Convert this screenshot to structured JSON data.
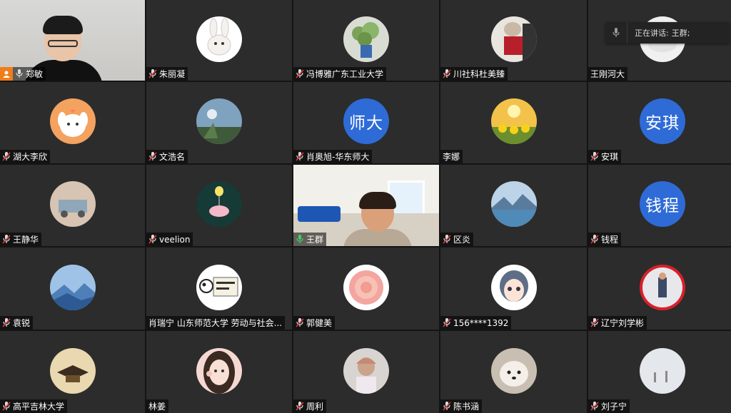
{
  "app": {
    "accent_color": "#2e6bd6",
    "active_border_color": "#1f9a4a",
    "host_badge_color": "#f07d1a"
  },
  "speaking_indicator": {
    "label": "正在讲话:",
    "name": "王群;"
  },
  "participants": [
    {
      "name": "郑敏",
      "mic": "on",
      "avatar": "video-man-glasses",
      "host": true
    },
    {
      "name": "朱丽凝",
      "mic": "muted",
      "avatar": "bunny-cartoon"
    },
    {
      "name": "冯博雅广东工业大学",
      "mic": "muted",
      "avatar": "potted-plant"
    },
    {
      "name": "川社科杜美臻",
      "mic": "muted",
      "avatar": "cat-with-red-book"
    },
    {
      "name": "王刚河大",
      "mic": "none",
      "avatar": "white-photo"
    },
    {
      "name": "湖大李欣",
      "mic": "muted",
      "avatar": "puppy-cartoon"
    },
    {
      "name": "文浩名",
      "mic": "muted",
      "avatar": "sky-landscape"
    },
    {
      "name": "肖奥旭-华东师大",
      "mic": "muted",
      "avatar_text": "师大"
    },
    {
      "name": "李娜",
      "mic": "none",
      "avatar": "sunflowers"
    },
    {
      "name": "安琪",
      "mic": "muted",
      "avatar_text": "安琪"
    },
    {
      "name": "王静华",
      "mic": "muted",
      "avatar": "toy-truck"
    },
    {
      "name": "veelion",
      "mic": "muted",
      "avatar": "whale-balloon"
    },
    {
      "name": "王群",
      "mic": "speaking",
      "avatar": "video-woman-room",
      "active": true
    },
    {
      "name": "区炎",
      "mic": "muted",
      "avatar": "mountain-lake"
    },
    {
      "name": "钱程",
      "mic": "muted",
      "avatar_text": "钱程"
    },
    {
      "name": "袁锐",
      "mic": "muted",
      "avatar": "blue-mountains"
    },
    {
      "name": "肖瑞宁 山东师范大学 劳动与社会...",
      "mic": "none",
      "avatar": "panda-sign"
    },
    {
      "name": "郭健美",
      "mic": "muted",
      "avatar": "pink-rose"
    },
    {
      "name": "156****1392",
      "mic": "muted",
      "avatar": "girl-cartoon"
    },
    {
      "name": "辽宁刘学彬",
      "mic": "muted",
      "avatar": "man-red-frame"
    },
    {
      "name": "高平吉林大学",
      "mic": "muted",
      "avatar": "graduation-cap"
    },
    {
      "name": "林姜",
      "mic": "none",
      "avatar": "girl-photo"
    },
    {
      "name": "周利",
      "mic": "muted",
      "avatar": "person-cap"
    },
    {
      "name": "陈书涵",
      "mic": "muted",
      "avatar": "white-dog"
    },
    {
      "name": "刘子宁",
      "mic": "muted",
      "avatar": "misty-figures"
    }
  ]
}
